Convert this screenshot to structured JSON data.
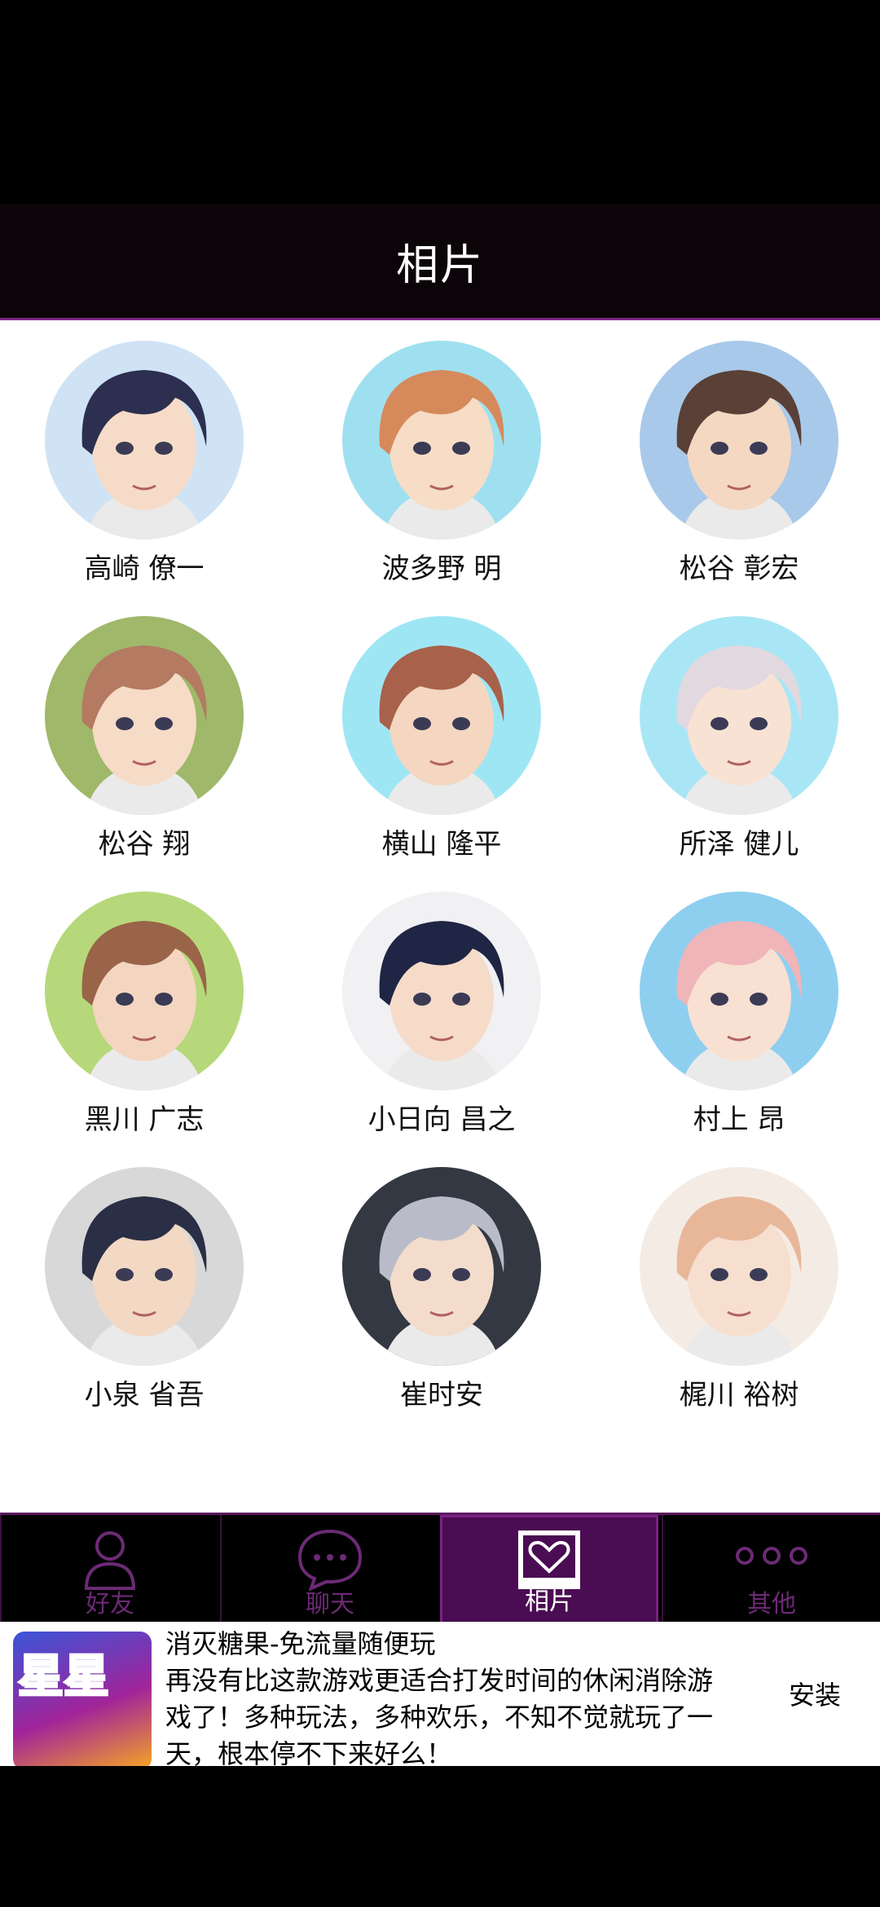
{
  "header": {
    "title": "相片"
  },
  "contacts": [
    {
      "name": "高崎 僚一",
      "hair": "#2c2f4f",
      "bg": "#cfe3f5",
      "skin": "#f6dcc8"
    },
    {
      "name": "波多野 明",
      "hair": "#d68a5b",
      "bg": "#9fe0f0",
      "skin": "#f7dcc6"
    },
    {
      "name": "松谷 彰宏",
      "hair": "#5a4036",
      "bg": "#a8c9ea",
      "skin": "#f4d8c2"
    },
    {
      "name": "松谷 翔",
      "hair": "#b47a62",
      "bg": "#9fb86a",
      "skin": "#f6dbc6"
    },
    {
      "name": "横山 隆平",
      "hair": "#a8624b",
      "bg": "#9fe6f5",
      "skin": "#f5d6c0"
    },
    {
      "name": "所泽 健儿",
      "hair": "#e2d9e0",
      "bg": "#a9e6f5",
      "skin": "#f8e2d3"
    },
    {
      "name": "黑川 广志",
      "hair": "#9a6449",
      "bg": "#b6d87a",
      "skin": "#f4d6c0"
    },
    {
      "name": "小日向 昌之",
      "hair": "#1f2544",
      "bg": "#f1f1f4",
      "skin": "#f6dbc8"
    },
    {
      "name": "村上 昂",
      "hair": "#f0b5b8",
      "bg": "#8ecff0",
      "skin": "#f8e0d2"
    },
    {
      "name": "小泉 省吾",
      "hair": "#2a2f45",
      "bg": "#d8d8d8",
      "skin": "#f3d8c4"
    },
    {
      "name": "崔时安",
      "hair": "#b9bcc8",
      "bg": "#333842",
      "skin": "#f3dccc"
    },
    {
      "name": "梶川 裕树",
      "hair": "#e8b79a",
      "bg": "#f4ece4",
      "skin": "#f7dfcf"
    }
  ],
  "tabs": [
    {
      "label": "好友",
      "icon": "person-icon"
    },
    {
      "label": "聊天",
      "icon": "chat-bubble-icon"
    },
    {
      "label": "相片",
      "icon": "heart-photo-icon",
      "active": true
    },
    {
      "label": "其他",
      "icon": "more-dots-icon"
    }
  ],
  "ad": {
    "title": "消灭糖果-免流量随便玩",
    "description": "再没有比这款游戏更适合打发时间的休闲消除游戏了！多种玩法，多种欢乐，不知不觉就玩了一天，根本停不下来好么！",
    "install_label": "安装",
    "icon_text": "星星"
  },
  "colors": {
    "accent": "#7d2a86",
    "active_tab": "#4a0c52",
    "inactive_tab_text": "#6c2a75"
  }
}
